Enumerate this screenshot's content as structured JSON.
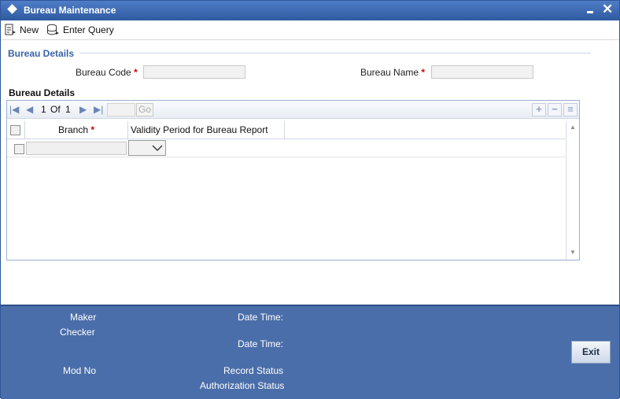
{
  "window": {
    "title": "Bureau Maintenance"
  },
  "toolbar": {
    "new_label": "New",
    "enter_query_label": "Enter Query"
  },
  "section": {
    "heading": "Bureau Details"
  },
  "form": {
    "bureau_code_label": "Bureau Code",
    "bureau_name_label": "Bureau Name",
    "required_mark": "*",
    "bureau_code_value": "",
    "bureau_name_value": ""
  },
  "grid": {
    "title": "Bureau Details",
    "pager": {
      "current": "1",
      "of_label": "Of",
      "total": "1",
      "go_label": "Go"
    },
    "columns": [
      "Branch",
      "Validity Period for Bureau Report"
    ],
    "rows": [
      {
        "branch": "",
        "validity_period": ""
      }
    ]
  },
  "footer": {
    "maker_label": "Maker",
    "checker_label": "Checker",
    "date_time_label_1": "Date Time:",
    "date_time_label_2": "Date Time:",
    "mod_no_label": "Mod No",
    "record_status_label": "Record Status",
    "authorization_status_label": "Authorization Status",
    "exit_label": "Exit"
  },
  "icons": {
    "new": "new-document-icon",
    "enter_query": "query-icon",
    "first": "first-page-icon",
    "prev": "previous-page-icon",
    "next": "next-page-icon",
    "last": "last-page-icon",
    "add_row": "add-row-icon",
    "delete_row": "delete-row-icon",
    "single_view": "single-view-icon"
  },
  "colors": {
    "accent": "#3a63a8",
    "titlebar": "#2e5a9f",
    "footer": "#4a6ea9",
    "required": "#cc0000"
  }
}
